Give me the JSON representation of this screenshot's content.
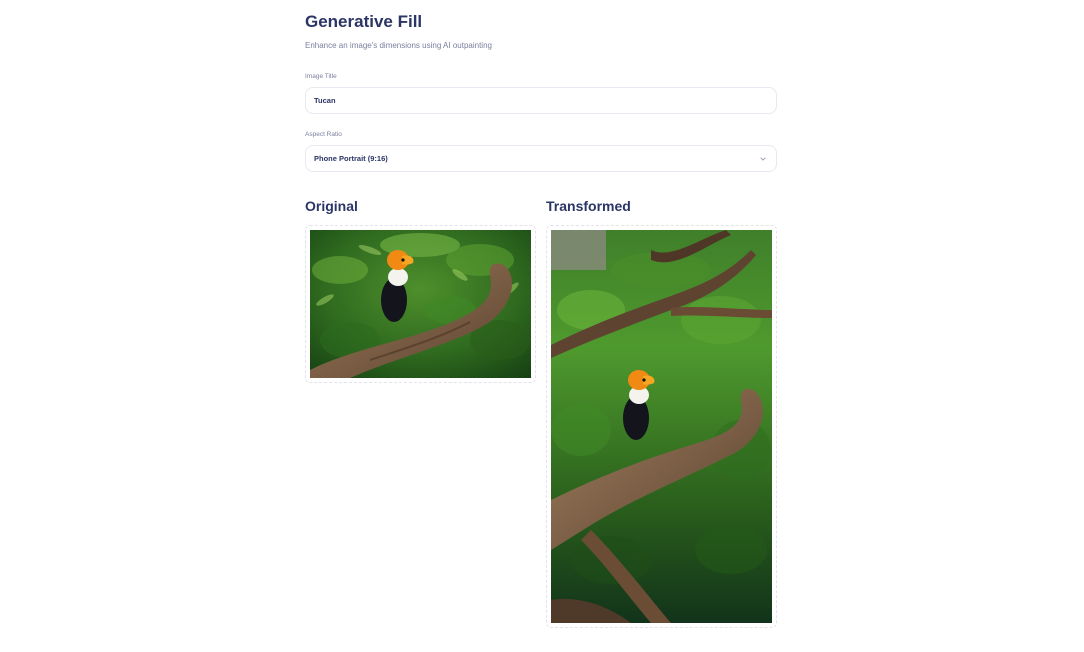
{
  "header": {
    "title": "Generative Fill",
    "subtitle": "Enhance an image's dimensions using AI outpainting"
  },
  "form": {
    "image_title": {
      "label": "Image Title",
      "value": "Tucan"
    },
    "aspect_ratio": {
      "label": "Aspect Ratio",
      "selected": "Phone Portrait (9:16)",
      "icon": "chevron-down-icon"
    }
  },
  "images": {
    "original": {
      "heading": "Original"
    },
    "transformed": {
      "heading": "Transformed"
    }
  },
  "colors": {
    "heading": "#2b3566",
    "muted": "#7b7f9e",
    "border": "#e7e8f0"
  }
}
